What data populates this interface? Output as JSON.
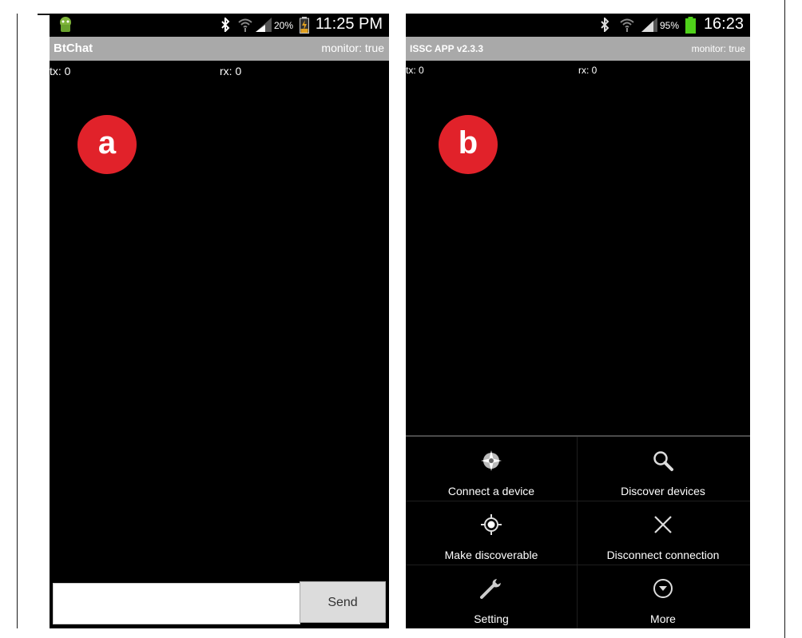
{
  "phone_a": {
    "status": {
      "battery_pct": "20%",
      "time": "11:25 PM"
    },
    "title": "BtChat",
    "monitor": "monitor: true",
    "tx": "tx: 0",
    "rx": "rx: 0",
    "badge": "a",
    "send_label": "Send",
    "message_input": {
      "value": "",
      "placeholder": ""
    }
  },
  "phone_b": {
    "status": {
      "battery_pct": "95%",
      "time": "16:23"
    },
    "title": "ISSC APP v2.3.3",
    "monitor": "monitor: true",
    "tx": "tx: 0",
    "rx": "rx: 0",
    "badge": "b",
    "menu": [
      {
        "label": "Connect a device",
        "icon": "compass-icon"
      },
      {
        "label": "Discover devices",
        "icon": "search-icon"
      },
      {
        "label": "Make discoverable",
        "icon": "target-icon"
      },
      {
        "label": "Disconnect connection",
        "icon": "close-icon"
      },
      {
        "label": "Setting",
        "icon": "wrench-icon"
      },
      {
        "label": "More",
        "icon": "chevron-down-circle-icon"
      }
    ]
  },
  "colors": {
    "badge_red": "#e1222a",
    "titlebar_gray": "#a9a9a9",
    "battery_green": "#4fd11a",
    "battery_orange": "#e0a020"
  }
}
